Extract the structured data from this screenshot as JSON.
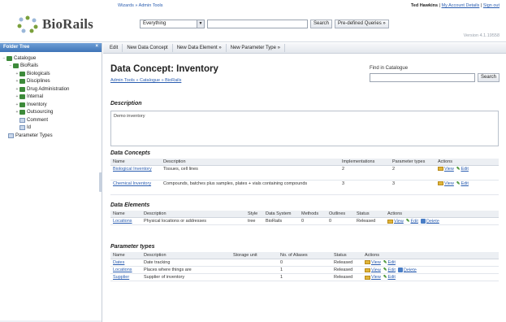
{
  "header": {
    "logo_text": "BioRails",
    "nav_text": "Wizards » Admin Tools",
    "user_name": "Ted Hawkins",
    "user_links": "My Account Details",
    "sign_out": "Sign out",
    "search_scope": "Everything",
    "search_button": "Search",
    "queries_button": "Pre-defined Queries »",
    "version": "Version 4.1.19558"
  },
  "sidebar": {
    "title": "Folder Tree",
    "close_glyph": "×",
    "items": [
      {
        "label": "Catalogue"
      },
      {
        "label": "BioRails"
      },
      {
        "label": "Biologicals"
      },
      {
        "label": "Disciplines"
      },
      {
        "label": "Drug Administration"
      },
      {
        "label": "Internal"
      },
      {
        "label": "Inventory"
      },
      {
        "label": "Outsourcing"
      },
      {
        "label": "Comment"
      },
      {
        "label": "Id"
      },
      {
        "label": "Parameter Types"
      }
    ]
  },
  "toolbar": {
    "edit": "Edit",
    "new_concept": "New Data Concept",
    "new_element": "New Data Element »",
    "new_param": "New Parameter Type »"
  },
  "main": {
    "title": "Data Concept: Inventory",
    "breadcrumb": "Admin Tools » Catalogue » BioRails",
    "find_label": "Find in Catalogue",
    "find_button": "Search",
    "description_heading": "Description",
    "description_text": "Demo inventory",
    "concepts_heading": "Data Concepts",
    "concepts_headers": [
      "Name",
      "Description",
      "Implementations",
      "Parameter types",
      "Actions"
    ],
    "concepts_rows": [
      {
        "name": "Biological Inventory",
        "desc": "Tissues, cell lines",
        "impl": "2",
        "ptypes": "2"
      },
      {
        "name": "Chemical Inventory",
        "desc": "Compounds, batches plus samples, plates + vials containing compounds",
        "impl": "3",
        "ptypes": "3"
      }
    ],
    "elements_heading": "Data Elements",
    "elements_headers": [
      "Name",
      "Description",
      "Style",
      "Data System",
      "Methods",
      "Outlines",
      "Status",
      "Actions"
    ],
    "elements_rows": [
      {
        "name": "Locations",
        "desc": "Physical locations or addresses",
        "style": "tree",
        "system": "BioRails",
        "methods": "0",
        "outlines": "0",
        "status": "Released"
      }
    ],
    "ptypes_heading": "Parameter types",
    "ptypes_headers": [
      "Name",
      "Description",
      "Storage unit",
      "No. of Aliases",
      "Status",
      "Actions"
    ],
    "ptypes_rows": [
      {
        "name": "Dates",
        "desc": "Date tracking",
        "unit": "",
        "aliases": "0",
        "status": "Released"
      },
      {
        "name": "Locations",
        "desc": "Places where things are",
        "unit": "",
        "aliases": "1",
        "status": "Released"
      },
      {
        "name": "Supplier",
        "desc": "Supplier of inventory",
        "unit": "",
        "aliases": "1",
        "status": "Released"
      }
    ],
    "action_view": "View",
    "action_edit": "Edit",
    "action_delete": "Delete"
  }
}
